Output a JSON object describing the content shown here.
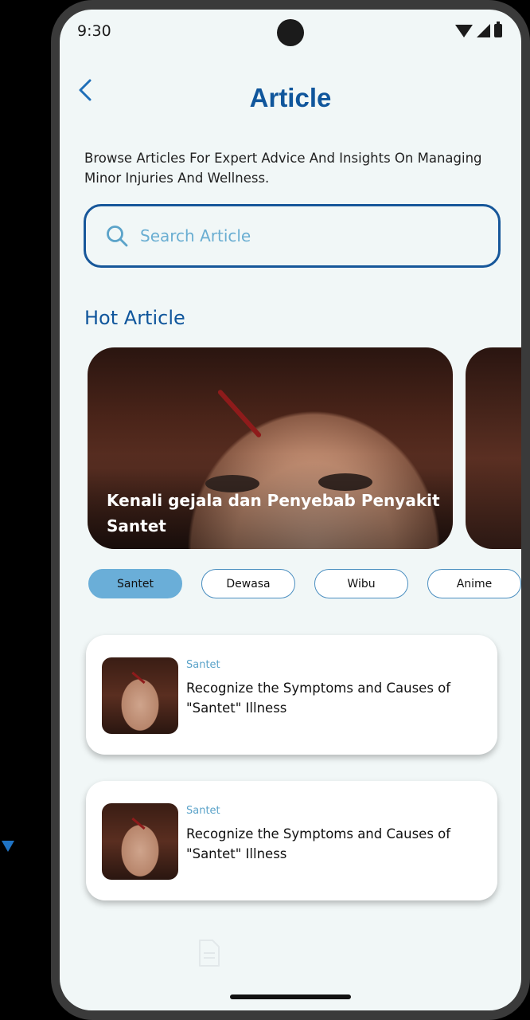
{
  "status_bar": {
    "time": "9:30"
  },
  "header": {
    "title": "Article"
  },
  "intro_text": "Browse Articles For Expert Advice And Insights On Managing Minor Injuries And Wellness.",
  "search": {
    "placeholder": "Search Article"
  },
  "hot_section": {
    "title": "Hot Article",
    "card_title": "Kenali gejala dan Penyebab Penyakit Santet"
  },
  "categories": [
    {
      "label": "Santet",
      "active": true
    },
    {
      "label": "Dewasa",
      "active": false
    },
    {
      "label": "Wibu",
      "active": false
    },
    {
      "label": "Anime",
      "active": false
    }
  ],
  "articles": [
    {
      "tag": "Santet",
      "title": "Recognize the Symptoms and Causes of \"Santet\" Illness"
    },
    {
      "tag": "Santet",
      "title": "Recognize the Symptoms and Causes of \"Santet\" Illness"
    }
  ],
  "colors": {
    "brand": "#10569c",
    "accent": "#6aaed8",
    "background": "#f1f7f7"
  },
  "icons": [
    "back-arrow-icon",
    "search-icon",
    "document-icon",
    "wifi-icon",
    "signal-icon",
    "battery-icon"
  ]
}
